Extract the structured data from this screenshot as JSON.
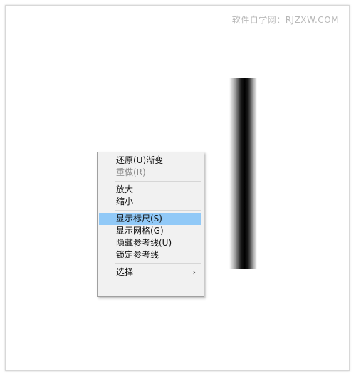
{
  "watermark": "软件自学网：RJZXW.COM",
  "menu": {
    "items": [
      {
        "label": "还原(U)渐变"
      },
      {
        "label": "重做(R)"
      },
      {
        "label": "放大"
      },
      {
        "label": "缩小"
      },
      {
        "label": "显示标尺(S)"
      },
      {
        "label": "显示网格(G)"
      },
      {
        "label": "隐藏参考线(U)"
      },
      {
        "label": "锁定参考线"
      },
      {
        "label": "选择",
        "arrow": "›"
      }
    ]
  },
  "colors": {
    "highlight": "#91c9f7",
    "menu_bg": "#f1f1f1"
  }
}
